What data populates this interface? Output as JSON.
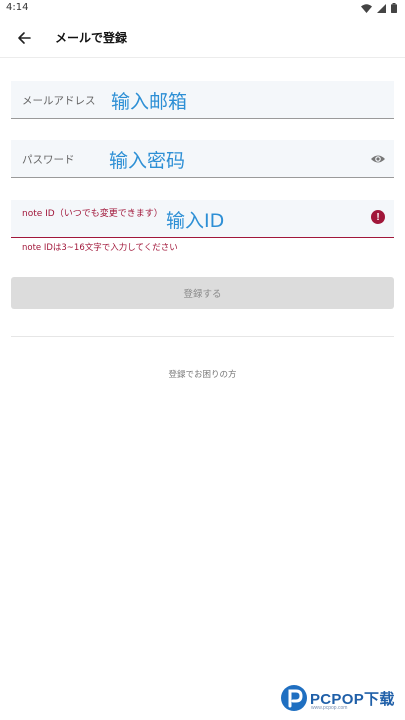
{
  "status_bar": {
    "time": "4:14"
  },
  "app_bar": {
    "title": "メールで登録"
  },
  "form": {
    "email": {
      "label": "メールアドレス",
      "value": "输入邮箱"
    },
    "password": {
      "label": "パスワード",
      "value": "输入密码"
    },
    "note_id": {
      "label": "note ID（いつでも変更できます）",
      "value": "输入ID",
      "error": "note IDは3~16文字で入力してください"
    },
    "submit_label": "登録する"
  },
  "help_link": "登録でお困りの方",
  "watermark": {
    "brand": "PCPOP下载",
    "tagline": "www.pcpop.com"
  },
  "colors": {
    "accent_blue": "#2d8fd5",
    "error": "#a1173a",
    "field_bg": "#f4f7fa",
    "button_disabled": "#dcdcdc"
  },
  "icons": {
    "back": "arrow-left-icon",
    "visibility": "eye-icon",
    "error": "error-icon",
    "wifi": "wifi-icon",
    "signal": "signal-icon",
    "battery": "battery-icon"
  }
}
